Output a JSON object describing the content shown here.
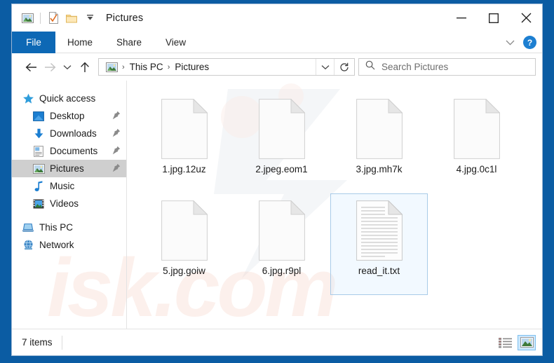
{
  "window": {
    "title": "Pictures",
    "quick_access_toolbar": [
      {
        "icon": "pictures-icon",
        "name": "properties-icon"
      },
      {
        "icon": "checkmark-document-icon",
        "name": "check-document-icon"
      },
      {
        "icon": "folder-icon",
        "name": "new-folder-icon"
      },
      {
        "icon": "chevron-down-icon",
        "name": "customize-qat-icon"
      }
    ],
    "controls": {
      "minimize": "minimize-icon",
      "maximize": "maximize-icon",
      "close": "close-icon"
    }
  },
  "ribbon": {
    "tabs": [
      {
        "label": "File",
        "active": true
      },
      {
        "label": "Home",
        "active": false
      },
      {
        "label": "Share",
        "active": false
      },
      {
        "label": "View",
        "active": false
      }
    ],
    "expand_icon": "chevron-down-icon",
    "help_label": "?"
  },
  "addressbar": {
    "back_icon": "arrow-left-icon",
    "forward_icon": "arrow-right-icon",
    "recent_icon": "chevron-down-icon",
    "up_icon": "arrow-up-icon",
    "location_icon": "pictures-icon",
    "crumbs": [
      "This PC",
      "Pictures"
    ],
    "crumb_separator": "›",
    "dropdown_icon": "chevron-down-icon",
    "refresh_icon": "refresh-icon"
  },
  "search": {
    "icon": "search-icon",
    "placeholder": "Search Pictures",
    "value": ""
  },
  "sidebar": {
    "items": [
      {
        "label": "Quick access",
        "icon": "star-icon",
        "indent": 0,
        "pinned": false,
        "selected": false
      },
      {
        "label": "Desktop",
        "icon": "desktop-icon",
        "indent": 1,
        "pinned": true,
        "selected": false
      },
      {
        "label": "Downloads",
        "icon": "download-icon",
        "indent": 1,
        "pinned": true,
        "selected": false
      },
      {
        "label": "Documents",
        "icon": "documents-icon",
        "indent": 1,
        "pinned": true,
        "selected": false
      },
      {
        "label": "Pictures",
        "icon": "pictures-icon",
        "indent": 1,
        "pinned": true,
        "selected": true
      },
      {
        "label": "Music",
        "icon": "music-note-icon",
        "indent": 1,
        "pinned": false,
        "selected": false
      },
      {
        "label": "Videos",
        "icon": "video-icon",
        "indent": 1,
        "pinned": false,
        "selected": false
      },
      {
        "label": "This PC",
        "icon": "computer-icon",
        "indent": 0,
        "pinned": false,
        "selected": false
      },
      {
        "label": "Network",
        "icon": "network-icon",
        "indent": 0,
        "pinned": false,
        "selected": false
      }
    ]
  },
  "files": [
    {
      "name": "1.jpg.12uz",
      "icon": "blank-document-icon",
      "selected": false
    },
    {
      "name": "2.jpeg.eom1",
      "icon": "blank-document-icon",
      "selected": false
    },
    {
      "name": "3.jpg.mh7k",
      "icon": "blank-document-icon",
      "selected": false
    },
    {
      "name": "4.jpg.0c1l",
      "icon": "blank-document-icon",
      "selected": false
    },
    {
      "name": "5.jpg.goiw",
      "icon": "blank-document-icon",
      "selected": false
    },
    {
      "name": "6.jpg.r9pl",
      "icon": "blank-document-icon",
      "selected": false
    },
    {
      "name": "read_it.txt",
      "icon": "text-document-icon",
      "selected": true
    }
  ],
  "statusbar": {
    "item_count": "7 items",
    "views": [
      {
        "name": "details-view-button",
        "active": false
      },
      {
        "name": "large-icons-view-button",
        "active": true
      }
    ]
  },
  "watermark": {
    "text": "isk.com"
  },
  "colors": {
    "window_border": "#0b5ca3",
    "file_tab": "#0d68b5",
    "selection_border": "#a8cbe8",
    "selection_fill": "#cce8ff",
    "nav_selected": "#cfcfcf",
    "help_blue": "#1d7fd1"
  }
}
